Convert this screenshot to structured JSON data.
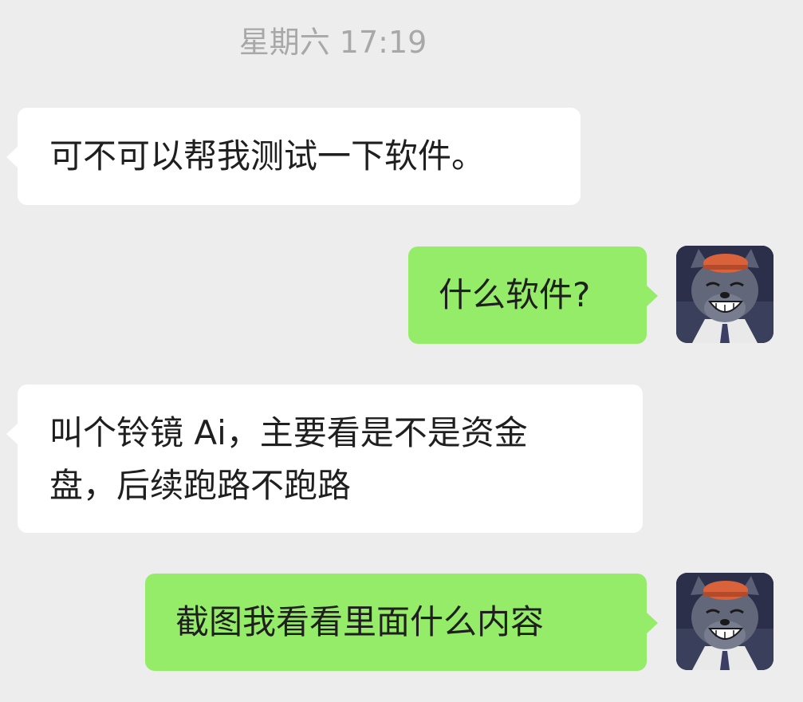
{
  "chat": {
    "timestamp": "星期六 17:19",
    "messages": [
      {
        "side": "incoming",
        "text": "可不可以帮我测试一下软件。"
      },
      {
        "side": "outgoing",
        "text": "什么软件?"
      },
      {
        "side": "incoming",
        "text": "叫个铃镜 Ai，主要看是不是资金\n盘，后续跑路不跑路"
      },
      {
        "side": "outgoing",
        "text": "截图我看看里面什么内容"
      }
    ],
    "avatar_icon": "cartoon-wolf-avatar"
  },
  "colors": {
    "background": "#ededed",
    "incoming_bubble": "#ffffff",
    "outgoing_bubble": "#95ec69",
    "timestamp_text": "#a8a8a8"
  }
}
